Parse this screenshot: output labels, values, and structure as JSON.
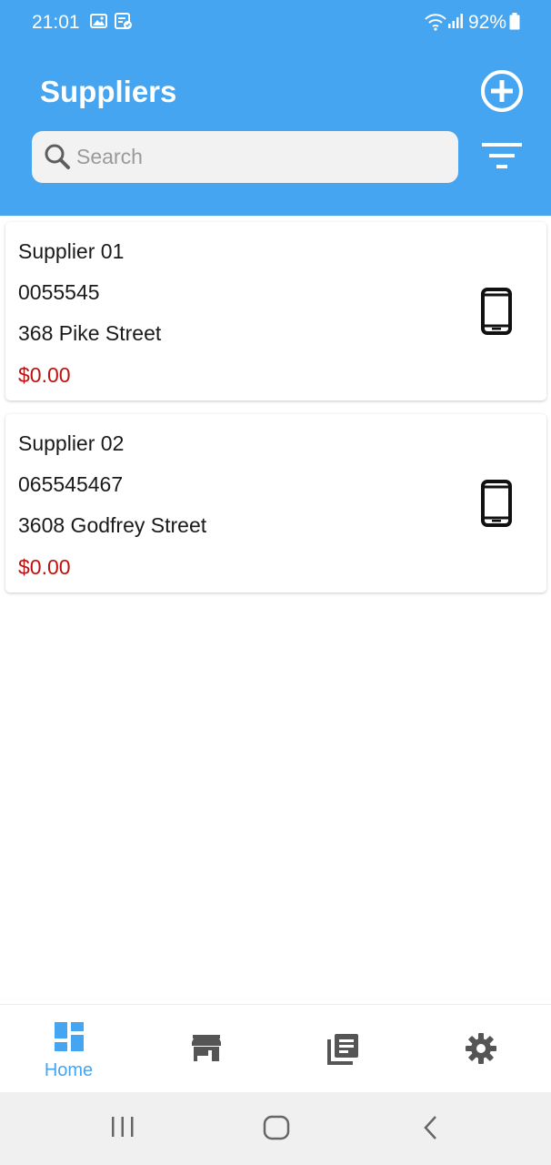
{
  "status_bar": {
    "time": "21:01",
    "battery": "92%"
  },
  "header": {
    "title": "Suppliers",
    "add_icon": "plus-circle-icon",
    "filter_icon": "filter-icon"
  },
  "search": {
    "placeholder": "Search",
    "value": ""
  },
  "suppliers": [
    {
      "name": "Supplier 01",
      "phone": "0055545",
      "address": "368 Pike Street",
      "balance": "$0.00"
    },
    {
      "name": "Supplier 02",
      "phone": "065545467",
      "address": "3608 Godfrey Street",
      "balance": "$0.00"
    }
  ],
  "bottom_nav": {
    "items": [
      {
        "label": "Home",
        "icon": "dashboard-icon",
        "active": true
      },
      {
        "label": "",
        "icon": "store-icon",
        "active": false
      },
      {
        "label": "",
        "icon": "library-books-icon",
        "active": false
      },
      {
        "label": "",
        "icon": "gear-icon",
        "active": false
      }
    ]
  },
  "colors": {
    "primary": "#45a5f1",
    "balance": "#c01010",
    "icon_gray": "#555555"
  }
}
